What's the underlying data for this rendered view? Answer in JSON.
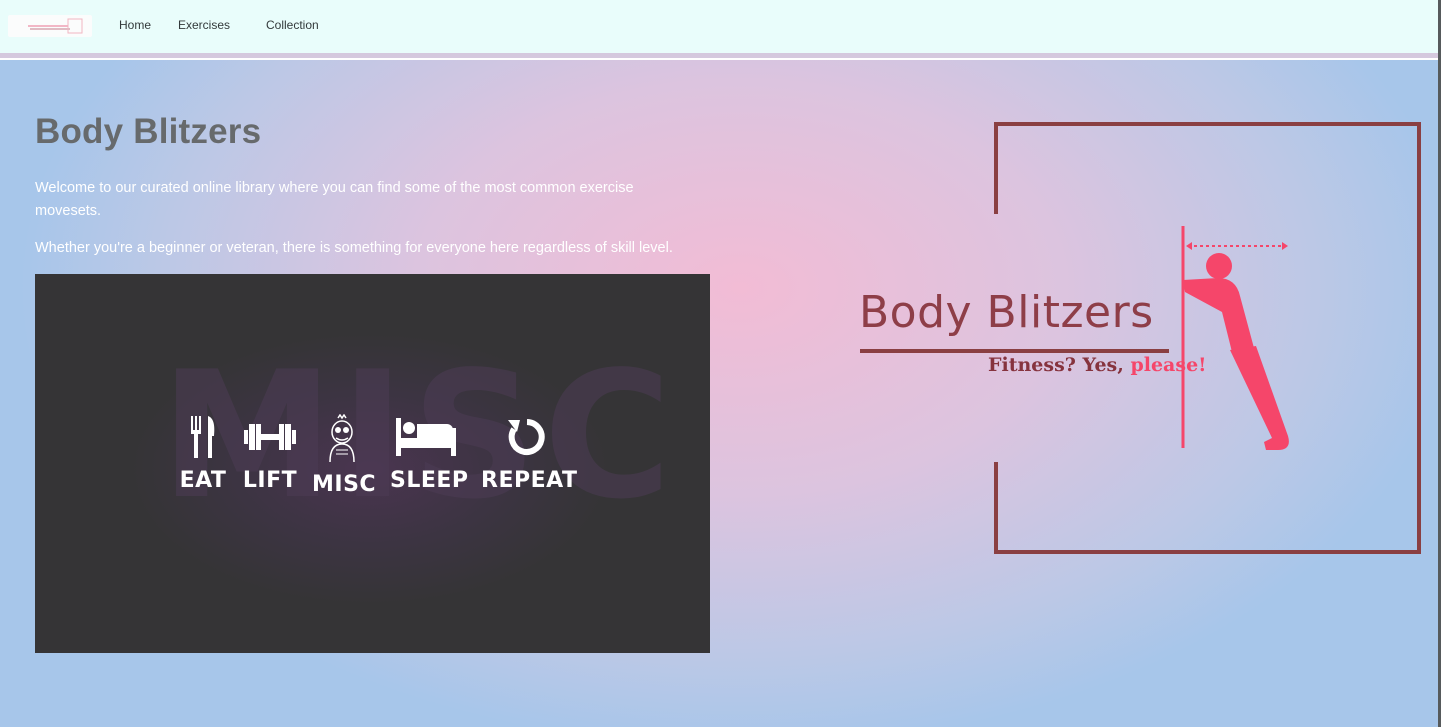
{
  "nav": {
    "links": [
      "Home",
      "Exercises",
      "Collection"
    ]
  },
  "hero": {
    "title": "Body Blitzers",
    "paragraph1": "Welcome to our curated online library where you can find some of the most common exercise movesets.",
    "paragraph2": "Whether you're a beginner or veteran, there is something for everyone here regardless of skill level."
  },
  "banner": {
    "background_text": "MISC",
    "items": [
      {
        "label": "EAT",
        "icon": "fork-knife-icon"
      },
      {
        "label": "LIFT",
        "icon": "dumbbell-icon"
      },
      {
        "label": "MISC",
        "icon": "cartoon-face-icon"
      },
      {
        "label": "SLEEP",
        "icon": "bed-icon"
      },
      {
        "label": "REPEAT",
        "icon": "repeat-arrow-icon"
      }
    ]
  },
  "logo": {
    "name": "Body Blitzers",
    "tagline_lead": "Fitness? Yes,",
    "tagline_accent": "please!",
    "colors": {
      "primary": "#8e3e48",
      "accent": "#f5466a",
      "frame": "#8a3f42"
    }
  }
}
